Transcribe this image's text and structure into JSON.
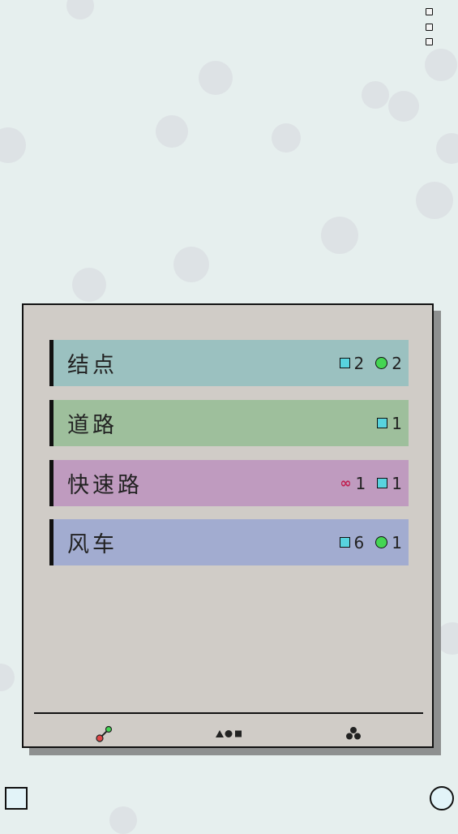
{
  "menu": {
    "icon": "three-square-menu-icon"
  },
  "rows": [
    {
      "label": "结点",
      "color": "#9bc1c0",
      "counts": [
        {
          "icon": "square-icon",
          "value": "2"
        },
        {
          "icon": "circle-icon",
          "value": "2"
        }
      ]
    },
    {
      "label": "道路",
      "color": "#9ebf9c",
      "counts": [
        {
          "icon": "square-icon",
          "value": "1"
        }
      ]
    },
    {
      "label": "快速路",
      "color": "#bf9bbf",
      "counts": [
        {
          "icon": "infinity-icon",
          "value": "1"
        },
        {
          "icon": "square-icon",
          "value": "1"
        }
      ]
    },
    {
      "label": "风车",
      "color": "#a2acd0",
      "counts": [
        {
          "icon": "square-icon",
          "value": "6"
        },
        {
          "icon": "circle-icon",
          "value": "1"
        }
      ]
    }
  ],
  "tabs": [
    {
      "icon": "road-nodes-icon"
    },
    {
      "icon": "shapes-icon"
    },
    {
      "icon": "cluster-icon"
    }
  ],
  "colors": {
    "background": "#e6efee",
    "panel": "#d0ccc7",
    "square_accent": "#58d3de",
    "circle_accent": "#44d553",
    "infinity_accent": "#c02050"
  }
}
